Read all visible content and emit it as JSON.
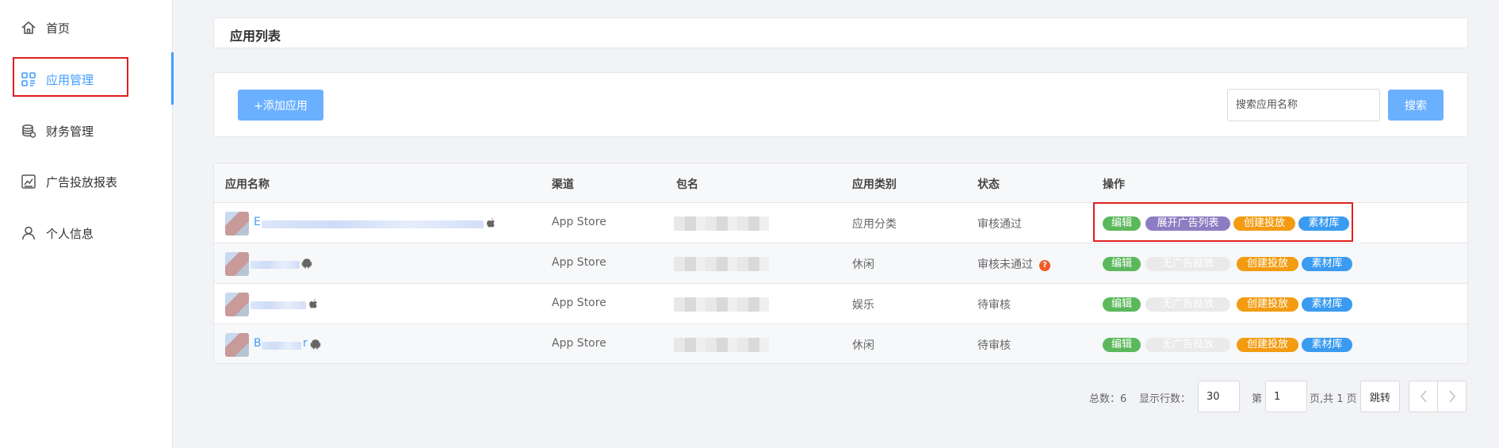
{
  "sidebar": {
    "items": [
      {
        "label": "首页",
        "icon": "home-icon"
      },
      {
        "label": "应用管理",
        "icon": "apps-grid-icon"
      },
      {
        "label": "财务管理",
        "icon": "coins-icon"
      },
      {
        "label": "广告投放报表",
        "icon": "chart-report-icon"
      },
      {
        "label": "个人信息",
        "icon": "user-icon"
      }
    ],
    "active_index": 1
  },
  "header": {
    "title": "应用列表"
  },
  "toolbar": {
    "add_label": "+添加应用",
    "search_placeholder": "搜索应用名称",
    "search_label": "搜索"
  },
  "table": {
    "columns": [
      "应用名称",
      "渠道",
      "包名",
      "应用类别",
      "状态",
      "操作"
    ],
    "rows": [
      {
        "name_prefix": "E",
        "name_suffix": "",
        "os": "apple-icon",
        "channel": "App Store",
        "category": "应用分类",
        "status": "审核通过",
        "status_help": false,
        "actions": [
          "编辑",
          "展开广告列表",
          "创建投放",
          "素材库"
        ],
        "expand_enabled": true
      },
      {
        "name_prefix": "",
        "name_suffix": "",
        "os": "android-icon",
        "channel": "App Store",
        "category": "休闲",
        "status": "审核未通过",
        "status_help": true,
        "actions": [
          "编辑",
          "无广告投放",
          "创建投放",
          "素材库"
        ],
        "expand_enabled": false
      },
      {
        "name_prefix": "",
        "name_suffix": "",
        "os": "apple-icon",
        "channel": "App Store",
        "category": "娱乐",
        "status": "待审核",
        "status_help": false,
        "actions": [
          "编辑",
          "无广告投放",
          "创建投放",
          "素材库"
        ],
        "expand_enabled": false
      },
      {
        "name_prefix": "B",
        "name_suffix": "r",
        "os": "android-icon",
        "channel": "App Store",
        "category": "休闲",
        "status": "待审核",
        "status_help": false,
        "actions": [
          "编辑",
          "无广告投放",
          "创建投放",
          "素材库"
        ],
        "expand_enabled": false
      }
    ]
  },
  "pagination": {
    "total_label": "总数：6",
    "rows_label": "显示行数：",
    "rows_value": "30",
    "page_prefix": "第",
    "page_value": "1",
    "page_suffix": "页,共 1 页",
    "jump_label": "跳转"
  },
  "colors": {
    "accent": "#409eff",
    "button": "#6ab0ff",
    "highlight": "#e02020",
    "tag_edit": "#5cb85c",
    "tag_expand": "#8c7dc2",
    "tag_create": "#f39c12",
    "tag_material": "#3a9bf0"
  }
}
